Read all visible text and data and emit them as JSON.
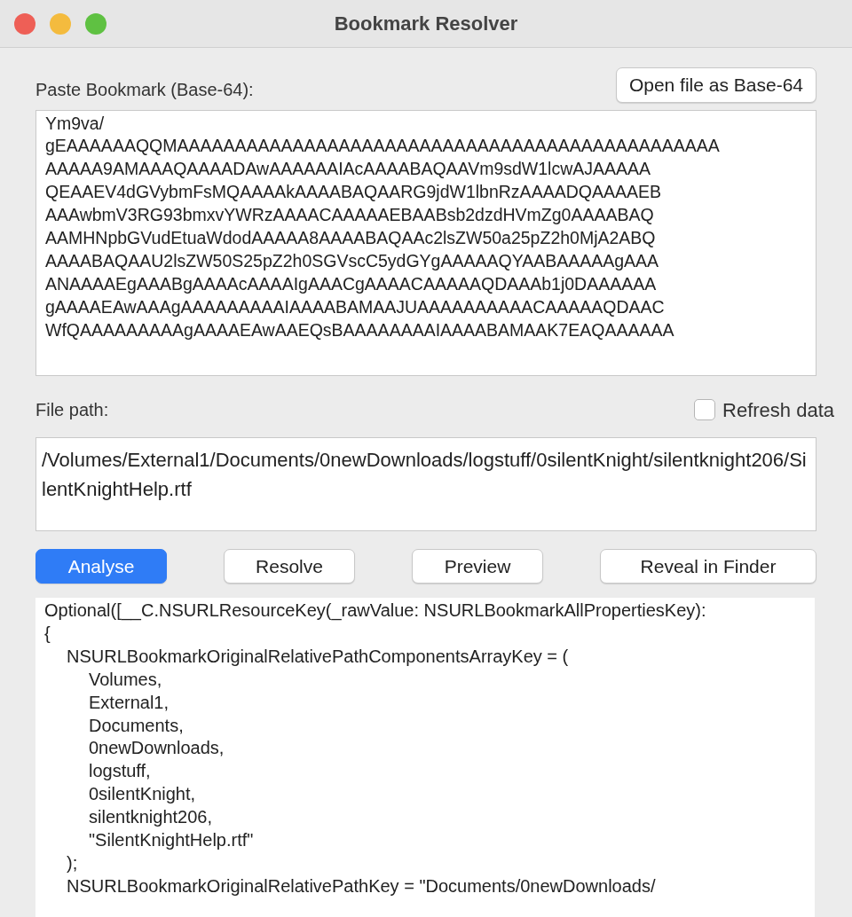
{
  "window": {
    "title": "Bookmark Resolver"
  },
  "bookmark": {
    "label": "Paste Bookmark (Base-64):",
    "open_button": "Open file as Base-64",
    "lines": [
      "Ym9va/",
      "gEAAAAAAQQMAAAAAAAAAAAAAAAAAAAAAAAAAAAAAAAAAAAAAAAAAAAAAAA",
      "AAAAA9AMAAAQAAAADAwAAAAAAIAcAAAABAQAAVm9sdW1lcwAJAAAAA",
      "QEAAEV4dGVybmFsMQAAAAkAAAABAQAARG9jdW1lbnRzAAAADQAAAAEB",
      "AAAwbmV3RG93bmxvYWRzAAAACAAAAAEBAABsb2dzdHVmZg0AAAABAQ",
      "AAMHNpbGVudEtuaWdodAAAAA8AAAABAQAAc2lsZW50a25pZ2h0MjA2ABQ",
      "AAAABAQAAU2lsZW50S25pZ2h0SGVscC5ydGYgAAAAAQYAABAAAAAgAAA",
      "ANAAAAEgAAABgAAAAcAAAAIgAAACgAAAACAAAAAQDAAAb1j0DAAAAAA",
      "gAAAAEAwAAAgAAAAAAAAAIAAAABAMAAJUAAAAAAAAAACAAAAAQDAAC",
      "WfQAAAAAAAAAgAAAAEAwAAEQsBAAAAAAAAIAAAABAMAAK7EAQAAAAAA"
    ]
  },
  "file_path": {
    "label": "File path:",
    "value": "/Volumes/External1/Documents/0newDownloads/logstuff/0silentKnight/silentknight206/SilentKnightHelp.rtf",
    "refresh": {
      "label": "Refresh data",
      "checked": false
    }
  },
  "buttons": [
    {
      "label": "Analyse",
      "default": true
    },
    {
      "label": "Resolve",
      "default": false
    },
    {
      "label": "Preview",
      "default": false
    },
    {
      "label": "Reveal in Finder",
      "default": false
    }
  ],
  "output": [
    {
      "kind": "top",
      "text": "Optional([__C.NSURLResourceKey(_rawValue: NSURLBookmarkAllPropertiesKey):"
    },
    {
      "kind": "top",
      "text": "{"
    },
    {
      "kind": "key",
      "text": "NSURLBookmarkOriginalRelativePathComponentsArrayKey =     ("
    },
    {
      "kind": "item",
      "text": "Volumes,"
    },
    {
      "kind": "item",
      "text": "External1,"
    },
    {
      "kind": "item",
      "text": "Documents,"
    },
    {
      "kind": "item",
      "text": "0newDownloads,"
    },
    {
      "kind": "item",
      "text": "logstuff,"
    },
    {
      "kind": "item",
      "text": "0silentKnight,"
    },
    {
      "kind": "item",
      "text": "silentknight206,"
    },
    {
      "kind": "item",
      "text": "\"SilentKnightHelp.rtf\""
    },
    {
      "kind": "key",
      "text": ");"
    },
    {
      "kind": "key",
      "text": "NSURLBookmarkOriginalRelativePathKey = \"Documents/0newDownloads/"
    }
  ]
}
